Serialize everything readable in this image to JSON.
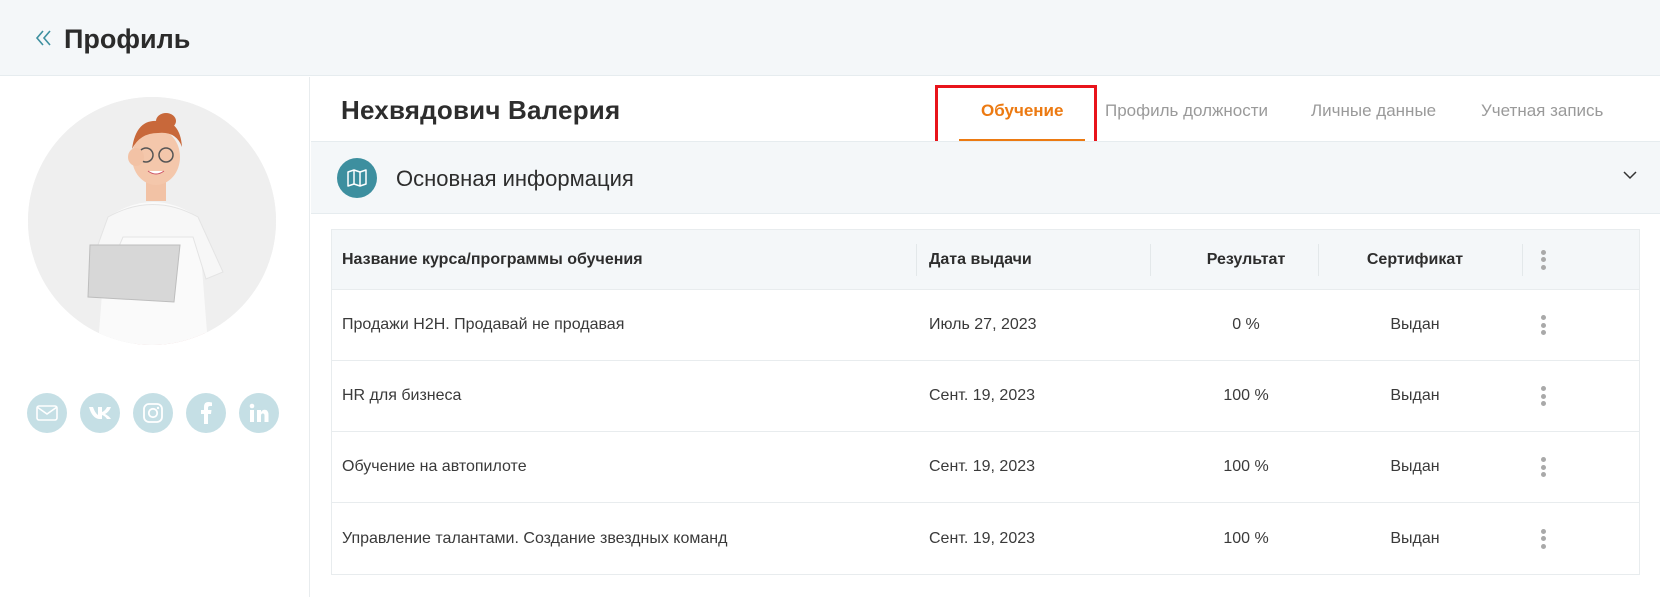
{
  "header": {
    "title": "Профиль",
    "back_icon": "double-chevron-left-icon"
  },
  "profile": {
    "name": "Нехвядович Валерия",
    "socials": [
      "mail-icon",
      "vk-icon",
      "instagram-icon",
      "facebook-icon",
      "linkedin-icon"
    ]
  },
  "tabs": [
    {
      "label": "Обучение",
      "active": true
    },
    {
      "label": "Профиль должности",
      "active": false
    },
    {
      "label": "Личные данные",
      "active": false
    },
    {
      "label": "Учетная запись",
      "active": false
    }
  ],
  "section": {
    "title": "Основная информация",
    "icon": "map-icon"
  },
  "table": {
    "headers": {
      "name": "Название курса/программы обучения",
      "date": "Дата выдачи",
      "result": "Результат",
      "certificate": "Сертификат"
    },
    "rows": [
      {
        "name": "Продажи H2H. Продавай не продавая",
        "date": "Июль 27, 2023",
        "result": "0 %",
        "certificate": "Выдан"
      },
      {
        "name": "HR для бизнеса",
        "date": "Сент. 19, 2023",
        "result": "100 %",
        "certificate": "Выдан"
      },
      {
        "name": "Обучение на автопилоте",
        "date": "Сент. 19, 2023",
        "result": "100 %",
        "certificate": "Выдан"
      },
      {
        "name": "Управление талантами. Создание звездных команд",
        "date": "Сент. 19, 2023",
        "result": "100 %",
        "certificate": "Выдан"
      }
    ]
  },
  "colors": {
    "accent": "#ec7a12",
    "teal": "#3d8f9f",
    "highlight": "#e8141b"
  }
}
